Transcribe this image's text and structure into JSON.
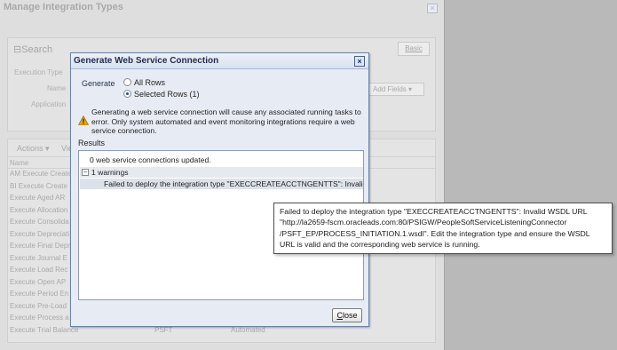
{
  "background": {
    "window_title": "Manage Integration Types",
    "close_glyph": "×",
    "search": {
      "title": "Search",
      "basic_label": "Basic",
      "labels": [
        "Execution Type",
        "Name",
        "Application"
      ],
      "add_fields_label": "Add Fields"
    },
    "table": {
      "actions_label": "Actions",
      "view_label": "View",
      "name_header": "Name",
      "rows": [
        "AM Execute Create",
        "BI Execute Create",
        "Execute Aged AR",
        "Execute Allocation",
        "Execute Consolida",
        "Execute Depreciati",
        "Execute Final Depr",
        "Execute Journal E",
        "Execute Load Rec",
        "Execute Open AP",
        "Execute Period En",
        "Execute Pre-Load",
        "Execute Process a"
      ],
      "last_row": {
        "name": "Execute Trial Balance",
        "app": "PSFT",
        "type": "Automated"
      }
    }
  },
  "dialog": {
    "title": "Generate Web Service Connection",
    "close_glyph": "×",
    "generate_label": "Generate",
    "options": [
      {
        "label": "All Rows",
        "selected": false
      },
      {
        "label": "Selected Rows (1)",
        "selected": true
      }
    ],
    "warning_lines": [
      "Generating a web service connection will cause any associated running tasks to",
      "error. Only system automated and event monitoring integrations require a web",
      "service connection."
    ],
    "results_label": "Results",
    "result_ok": "0 web service connections updated.",
    "warnings_toggle": "−",
    "warnings_label": "1 warnings",
    "failed_message": "Failed to deploy the integration type \"EXECCREATEACCTNGENTTS\": Invalid '",
    "close_prefix": "C",
    "close_rest": "lose"
  },
  "tooltip": {
    "lines": [
      "Failed to deploy the integration type \"EXECCREATEACCTNGENTTS\": Invalid WSDL URL",
      "\"http://la2659-fscm.oracleads.com:80/PSIGW/PeopleSoftServiceListeningConnector",
      "/PSFT_EP/PROCESS_INITIATION.1.wsdl\". Edit the integration type and ensure the WSDL",
      "URL is valid and the corresponding web service is running."
    ]
  },
  "colors": {
    "dialog_border": "#6b82a6",
    "warning_icon": "#e9a400",
    "dimmed_background": "#dedede"
  }
}
